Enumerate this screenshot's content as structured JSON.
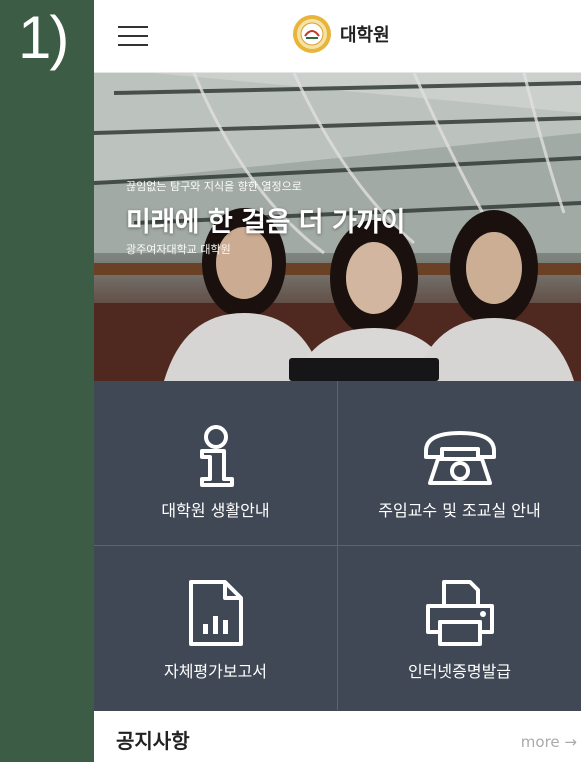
{
  "step_number": "1)",
  "header": {
    "logo_text": "대학원"
  },
  "hero": {
    "subtitle": "끊임없는 탐구와 지식을 향한 열정으로",
    "title": "미래에 한 걸음 더 가까이",
    "school": "광주여자대학교 대학원"
  },
  "tiles": [
    {
      "label": "대학원 생활안내",
      "icon": "info-icon"
    },
    {
      "label": "주임교수 및 조교실 안내",
      "icon": "telephone-icon"
    },
    {
      "label": "자체평가보고서",
      "icon": "report-chart-icon"
    },
    {
      "label": "인터넷증명발급",
      "icon": "printer-icon"
    }
  ],
  "notice": {
    "title": "공지사항",
    "more": "more →"
  },
  "colors": {
    "page_bg": "#3d5c45",
    "tile_bg": "#404855",
    "notice_more": "#aaaaaa"
  }
}
